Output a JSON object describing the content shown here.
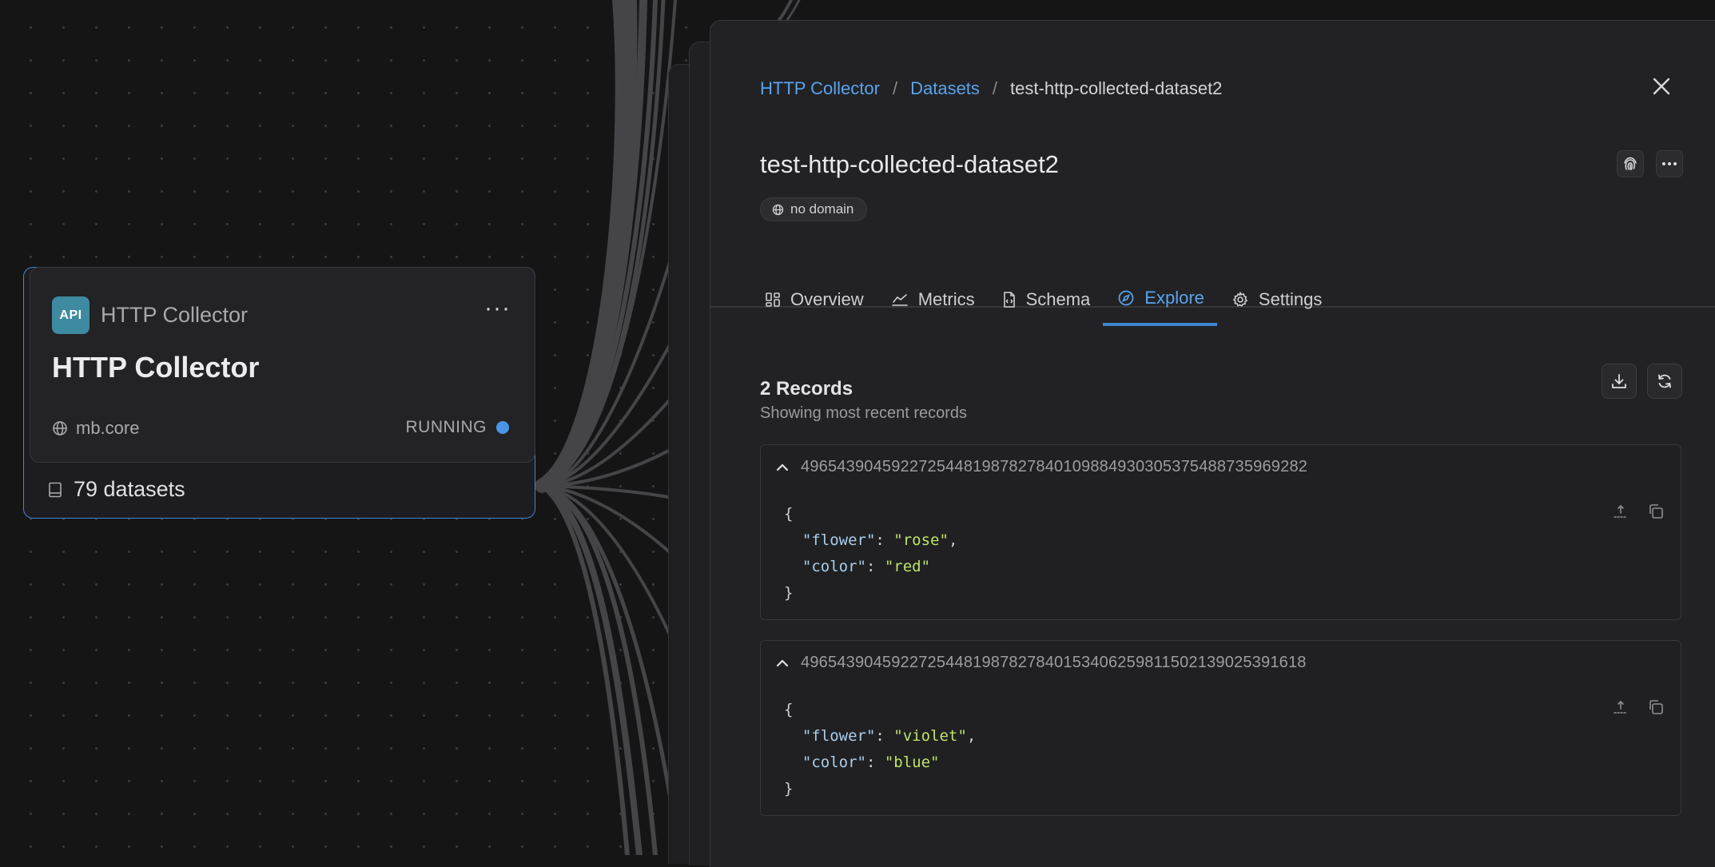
{
  "node": {
    "badge": "API",
    "kind": "HTTP Collector",
    "title": "HTTP Collector",
    "domain": "mb.core",
    "status": "RUNNING",
    "datasets": "79 datasets",
    "menu": "···"
  },
  "panel": {
    "breadcrumb": [
      "HTTP Collector",
      "Datasets",
      "test-http-collected-dataset2"
    ],
    "breadcrumb_sep": "/",
    "title": "test-http-collected-dataset2",
    "domain_pill": "no domain",
    "tabs": [
      {
        "label": "Overview",
        "icon": "overview-icon"
      },
      {
        "label": "Metrics",
        "icon": "metrics-icon"
      },
      {
        "label": "Schema",
        "icon": "schema-icon"
      },
      {
        "label": "Explore",
        "icon": "explore-icon",
        "active": true
      },
      {
        "label": "Settings",
        "icon": "gear-icon"
      }
    ]
  },
  "records": {
    "count": "2 Records",
    "subtitle": "Showing most recent records",
    "items": [
      {
        "id": "49654390459227254481987827840109884930305375488735969282",
        "json": {
          "flower": "rose",
          "color": "red"
        }
      },
      {
        "id": "49654390459227254481987827840153406259811502139025391618",
        "json": {
          "flower": "violet",
          "color": "blue"
        }
      }
    ]
  },
  "colors": {
    "accent": "#5aa3ec",
    "status_running": "#4a94e6",
    "api_badge": "#3d8aa1",
    "json_key": "#a8ceec",
    "json_string": "#bde36a"
  }
}
